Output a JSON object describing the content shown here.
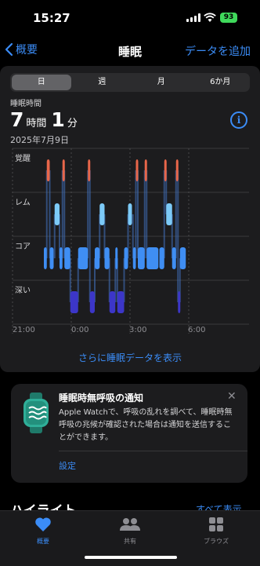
{
  "status": {
    "time": "15:27",
    "battery": "93"
  },
  "nav": {
    "back_label": "概要",
    "title": "睡眠",
    "action_label": "データを追加"
  },
  "segments": [
    "日",
    "週",
    "月",
    "6か月"
  ],
  "summary": {
    "label": "睡眠時間",
    "hours": "7",
    "hours_unit": "時間",
    "minutes": "1",
    "minutes_unit": "分",
    "date": "2025年7月9日"
  },
  "chart_data": {
    "type": "bar",
    "stages": [
      "覚醒",
      "レム",
      "コア",
      "深い"
    ],
    "x_ticks": [
      "21:00",
      "0:00",
      "3:00",
      "6:00"
    ],
    "colors": {
      "awake": "#e8664a",
      "rem": "#7ccaf8",
      "core": "#3f8ef3",
      "deep": "#3c36c8"
    },
    "segments": [
      {
        "stage": "core",
        "start": "22:36",
        "end": "22:45"
      },
      {
        "stage": "awake",
        "start": "22:45",
        "end": "22:54"
      },
      {
        "stage": "core",
        "start": "22:54",
        "end": "23:06"
      },
      {
        "stage": "rem",
        "start": "23:09",
        "end": "23:24"
      },
      {
        "stage": "core",
        "start": "23:24",
        "end": "23:33"
      },
      {
        "stage": "awake",
        "start": "23:33",
        "end": "23:39"
      },
      {
        "stage": "core",
        "start": "23:39",
        "end": "23:57"
      },
      {
        "stage": "deep",
        "start": "23:57",
        "end": "0:21"
      },
      {
        "stage": "core",
        "start": "0:21",
        "end": "0:51"
      },
      {
        "stage": "awake",
        "start": "0:51",
        "end": "0:57"
      },
      {
        "stage": "deep",
        "start": "0:57",
        "end": "1:12"
      },
      {
        "stage": "core",
        "start": "1:12",
        "end": "1:27"
      },
      {
        "stage": "rem",
        "start": "1:27",
        "end": "1:42"
      },
      {
        "stage": "core",
        "start": "1:42",
        "end": "1:57"
      },
      {
        "stage": "deep",
        "start": "1:57",
        "end": "2:15"
      },
      {
        "stage": "core",
        "start": "2:15",
        "end": "2:21"
      },
      {
        "stage": "deep",
        "start": "2:21",
        "end": "2:42"
      },
      {
        "stage": "core",
        "start": "2:42",
        "end": "2:54"
      },
      {
        "stage": "rem",
        "start": "2:54",
        "end": "3:06"
      },
      {
        "stage": "core",
        "start": "3:09",
        "end": "3:18"
      },
      {
        "stage": "awake",
        "start": "3:18",
        "end": "3:24"
      },
      {
        "stage": "core",
        "start": "3:24",
        "end": "3:45"
      },
      {
        "stage": "awake",
        "start": "3:45",
        "end": "3:51"
      },
      {
        "stage": "core",
        "start": "3:51",
        "end": "4:27"
      },
      {
        "stage": "core",
        "start": "4:30",
        "end": "4:45"
      },
      {
        "stage": "awake",
        "start": "4:45",
        "end": "4:51"
      },
      {
        "stage": "rem",
        "start": "4:51",
        "end": "5:09"
      },
      {
        "stage": "core",
        "start": "5:09",
        "end": "5:21"
      },
      {
        "stage": "awake",
        "start": "5:21",
        "end": "5:27"
      },
      {
        "stage": "deep",
        "start": "5:27",
        "end": "5:33"
      },
      {
        "stage": "core",
        "start": "5:33",
        "end": "5:51"
      }
    ]
  },
  "more_link": "さらに睡眠データを表示",
  "notification": {
    "title": "睡眠時無呼吸の通知",
    "body": "Apple Watchで、呼吸の乱れを調べて、睡眠時無呼吸の兆候が確認された場合は通知を送信することができます。",
    "settings_label": "設定",
    "icon": "watch-breathing-icon",
    "close_icon": "close-icon"
  },
  "highlights": {
    "title": "ハイライト",
    "show_all": "すべて表示"
  },
  "tabs": [
    {
      "label": "概要",
      "icon": "heart-icon",
      "active": true
    },
    {
      "label": "共有",
      "icon": "people-icon",
      "active": false
    },
    {
      "label": "ブラウズ",
      "icon": "grid-icon",
      "active": false
    }
  ]
}
